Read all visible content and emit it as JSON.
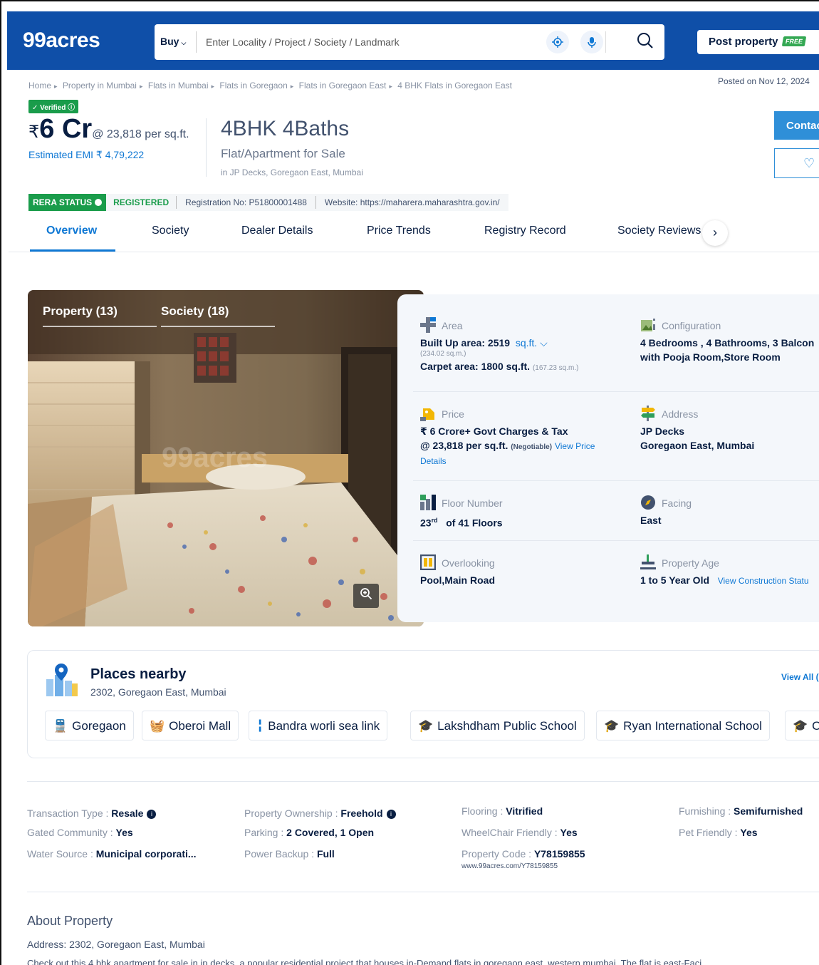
{
  "header": {
    "logo": "99acres",
    "buy_label": "Buy",
    "search_placeholder": "Enter Locality / Project / Society / Landmark",
    "post_property_label": "Post property",
    "free_badge": "FREE"
  },
  "breadcrumbs": [
    "Home",
    "Property in Mumbai",
    "Flats in Mumbai",
    "Flats in Goregaon",
    "Flats in Goregaon East",
    "4 BHK Flats in Goregaon East"
  ],
  "posted_on": "Posted on Nov 12, 2024",
  "listing": {
    "verified_label": "Verified",
    "currency": "₹",
    "price": "6 Cr",
    "price_per_sqft": "@ 23,818 per sq.ft.",
    "emi": "Estimated EMI ₹ 4,79,222",
    "title": "4BHK 4Baths",
    "subtitle": "Flat/Apartment for Sale",
    "location": "in JP Decks, Goregaon East, Mumbai",
    "contact_label": "Contac"
  },
  "rera": {
    "status_label": "RERA STATUS",
    "registered": "REGISTERED",
    "registration": "Registration No: P51800001488",
    "website": "Website: https://maharera.maharashtra.gov.in/"
  },
  "tabs": [
    "Overview",
    "Society",
    "Dealer Details",
    "Price Trends",
    "Registry Record",
    "Society Reviews"
  ],
  "gallery": {
    "property_tab": "Property (13)",
    "society_tab": "Society (18)",
    "watermark": "99acres"
  },
  "details": {
    "area": {
      "label": "Area",
      "built_up": "Built Up area: 2519",
      "unit": "sq.ft.",
      "built_up_sqm": "(234.02 sq.m.)",
      "carpet": "Carpet area: 1800 sq.ft.",
      "carpet_sqm": "(167.23 sq.m.)"
    },
    "configuration": {
      "label": "Configuration",
      "line1": "4 Bedrooms , 4 Bathrooms, 3 Balcon",
      "line2": "with Pooja Room,Store Room"
    },
    "price": {
      "label": "Price",
      "line1": "₹ 6 Crore+ Govt Charges & Tax",
      "line2": "@ 23,818 per sq.ft.",
      "negotiable": "(Negotiable)",
      "link1": "View Price",
      "link2": "Details"
    },
    "address": {
      "label": "Address",
      "line1": "JP Decks",
      "line2": "Goregaon East, Mumbai"
    },
    "floor": {
      "label": "Floor Number",
      "value": "23",
      "suffix": "rd",
      "total": "of 41 Floors"
    },
    "facing": {
      "label": "Facing",
      "value": "East"
    },
    "overlooking": {
      "label": "Overlooking",
      "value": "Pool,Main Road"
    },
    "age": {
      "label": "Property Age",
      "value": "1 to 5 Year Old",
      "link": "View Construction Statu"
    }
  },
  "places": {
    "title": "Places nearby",
    "address": "2302, Goregaon East, Mumbai",
    "view_all": "View All (",
    "chips": [
      "Goregaon",
      "Oberoi Mall",
      "Bandra worli sea link",
      "Lakshdham Public School",
      "Ryan International School",
      "O"
    ]
  },
  "facts": {
    "transaction_label": "Transaction Type : ",
    "transaction_value": "Resale",
    "ownership_label": "Property Ownership : ",
    "ownership_value": "Freehold",
    "flooring_label": "Flooring : ",
    "flooring_value": "Vitrified",
    "furnishing_label": "Furnishing : ",
    "furnishing_value": "Semifurnished",
    "gated_label": "Gated Community : ",
    "gated_value": "Yes",
    "parking_label": "Parking : ",
    "parking_value": "2 Covered, 1 Open",
    "wheelchair_label": "WheelChair Friendly : ",
    "wheelchair_value": "Yes",
    "pet_label": "Pet Friendly : ",
    "pet_value": "Yes",
    "water_label": "Water Source : ",
    "water_value": "Municipal corporati...",
    "backup_label": "Power Backup : ",
    "backup_value": "Full",
    "code_label": "Property Code : ",
    "code_value": "Y78159855",
    "code_url": "www.99acres.com/Y78159855"
  },
  "about": {
    "title": "About Property",
    "address": "Address: 2302, Goregaon East, Mumbai",
    "description": "Check out this 4 bhk apartment for sale in jp decks, a popular residential project that houses in-Demand flats in goregaon east, western mumbai. The flat is east-Faci"
  },
  "colors": {
    "brand_blue": "#0F4FA8",
    "accent_blue": "#0F78D4",
    "green": "#1A9C4B"
  }
}
